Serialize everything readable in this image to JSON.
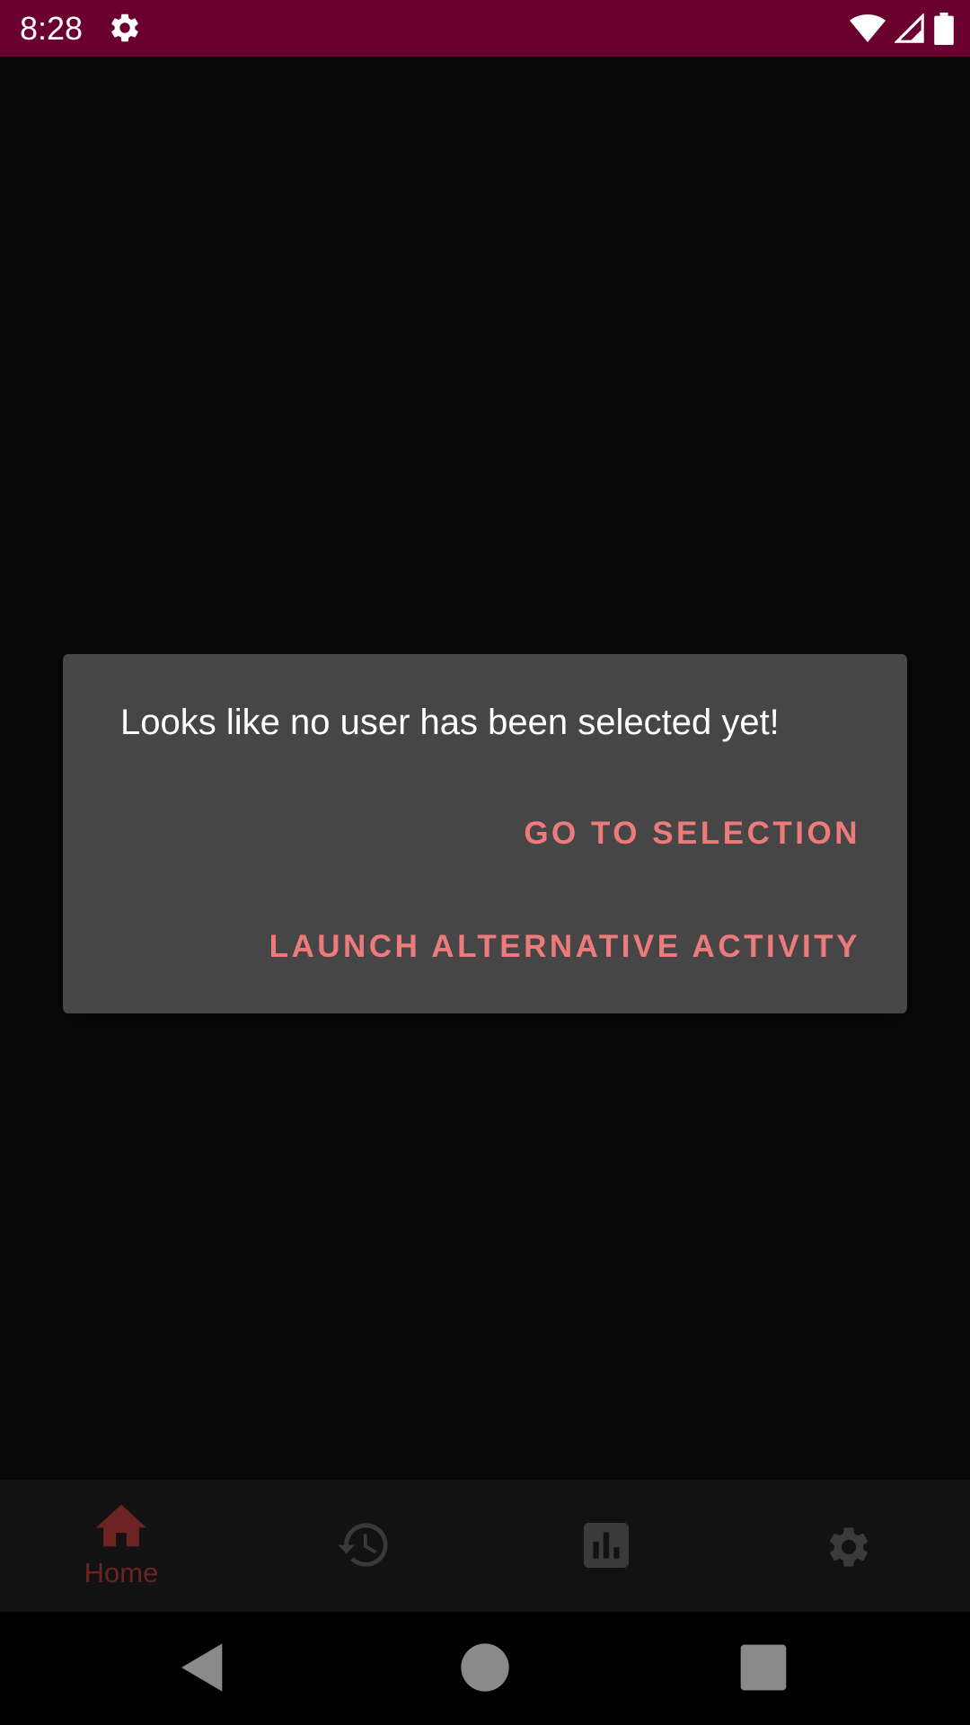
{
  "status_bar": {
    "time": "8:28",
    "icons": [
      "gear-icon",
      "wifi-icon",
      "signal-icon",
      "battery-icon"
    ],
    "background": "#6a0030"
  },
  "dialog": {
    "message": "Looks like no user has been selected yet!",
    "buttons": {
      "go_to_selection": "GO TO SELECTION",
      "launch_alternative": "LAUNCH ALTERNATIVE ACTIVITY"
    },
    "background": "#464646",
    "button_color": "#ee7b7b"
  },
  "bottom_nav": {
    "items": [
      {
        "icon": "home-icon",
        "label": "Home",
        "selected": true
      },
      {
        "icon": "history-icon",
        "label": "",
        "selected": false
      },
      {
        "icon": "bar-chart-icon",
        "label": "",
        "selected": false
      },
      {
        "icon": "settings-icon",
        "label": "",
        "selected": false
      }
    ],
    "selected_color": "#6b2323",
    "unselected_color": "#3a3a3a"
  },
  "system_nav": {
    "buttons": [
      "back-icon",
      "home-circle-icon",
      "recents-icon"
    ]
  }
}
